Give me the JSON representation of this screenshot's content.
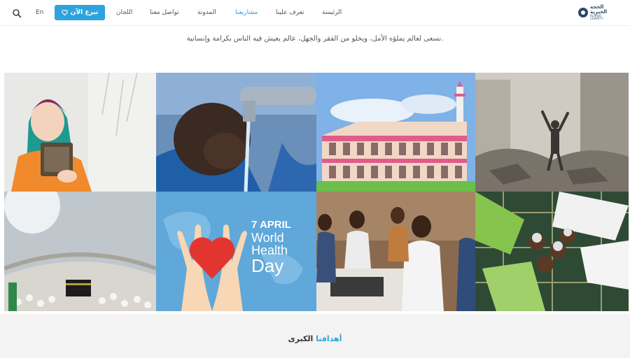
{
  "header": {
    "logo": {
      "ar": "الحجة الخيرية",
      "en": "ALHAJA CHARITY"
    },
    "nav": [
      {
        "label": "الرئيسة",
        "active": false
      },
      {
        "label": "تعرف علينا",
        "active": false
      },
      {
        "label": "مشاريعنا",
        "active": true
      },
      {
        "label": "المدونة",
        "active": false
      },
      {
        "label": "تواصل معنا",
        "active": false
      },
      {
        "label": "اللجان",
        "active": false
      }
    ],
    "donate_label": "تبرع الآن",
    "lang_label": "En",
    "icons": {
      "search": "search-icon",
      "donate": "heart-icon"
    }
  },
  "tagline": "نسعى لعالم يملؤه الأمل، ويخلو من الفقر والجهل، عالم يعيش فيه الناس بكرامة وإنسانية.",
  "tiles": {
    "health_day": {
      "line1": "7 APRIL",
      "line2": "World",
      "line3": "Health",
      "line4": "Day"
    }
  },
  "goals": {
    "highlight": "أهدافنا",
    "rest": " الكبرى"
  },
  "colors": {
    "accent": "#2fa3dd",
    "text": "#555555",
    "bottom_bg": "#f3f3f3"
  }
}
